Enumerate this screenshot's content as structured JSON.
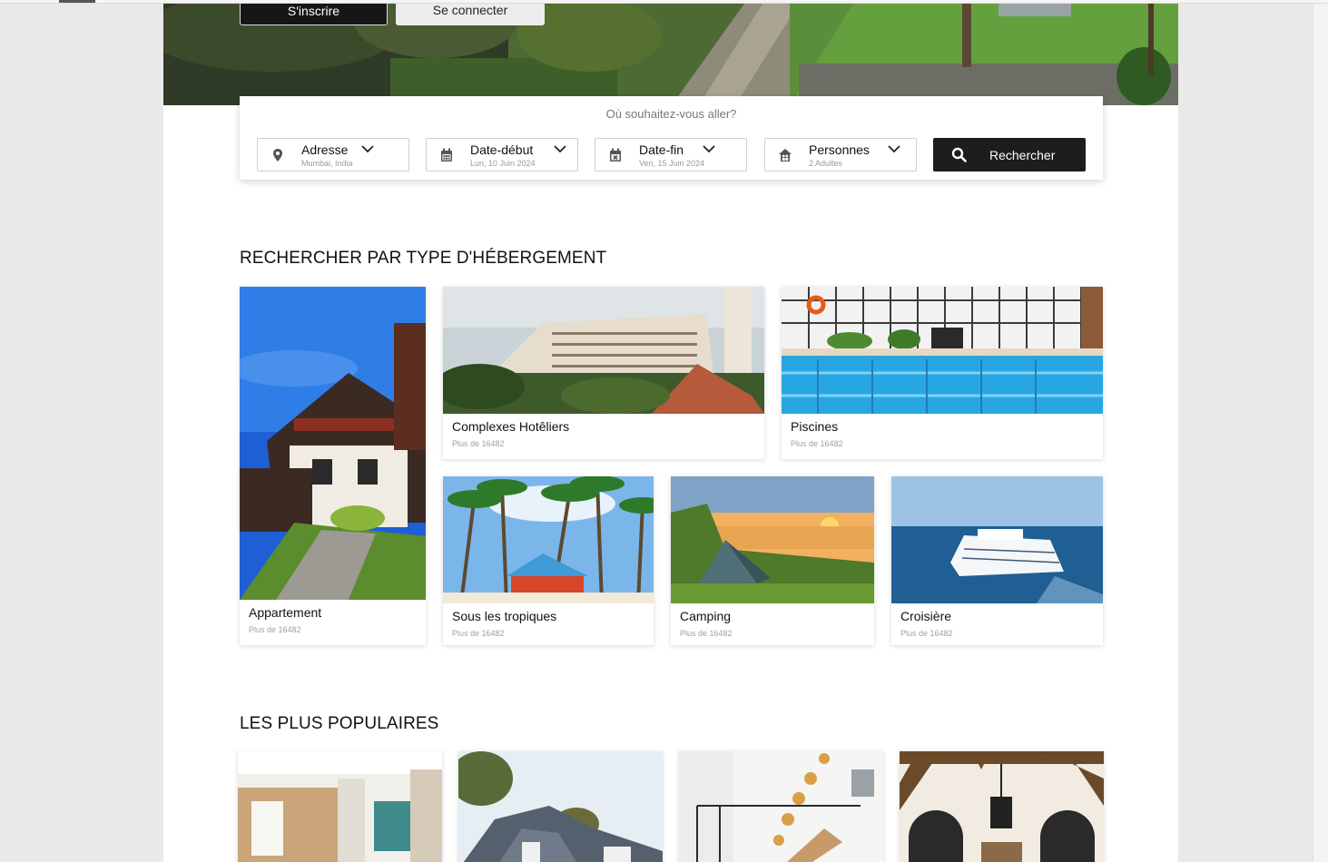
{
  "header": {
    "signup_label": "S'inscrire",
    "login_label": "Se connecter"
  },
  "search": {
    "question": "Où souhaitez-vous aller?",
    "fields": [
      {
        "label": "Adresse",
        "value": "Mumbai, India",
        "icon": "location-pin-icon"
      },
      {
        "label": "Date-début",
        "value": "Lun, 10 Juin 2024",
        "icon": "calendar-icon"
      },
      {
        "label": "Date-fin",
        "value": "Ven, 15 Juin 2024",
        "icon": "calendar-x-icon"
      },
      {
        "label": "Personnes",
        "value": "2 Adultes",
        "icon": "people-house-icon"
      }
    ],
    "button_label": "Rechercher"
  },
  "types_section": {
    "title": "RECHERCHER PAR TYPE D'HÉBERGEMENT",
    "items": [
      {
        "name": "Appartement",
        "meta": "Plus de 16482"
      },
      {
        "name": "Complexes Hotêliers",
        "meta": "Plus de 16482"
      },
      {
        "name": "Piscines",
        "meta": "Plus de 16482"
      },
      {
        "name": "Sous les tropiques",
        "meta": "Plus de 16482"
      },
      {
        "name": "Camping",
        "meta": "Plus de 16482"
      },
      {
        "name": "Croisière",
        "meta": "Plus de 16482"
      }
    ]
  },
  "popular_section": {
    "title": "LES PLUS POPULAIRES"
  },
  "colors": {
    "dark_button": "#1d1d1d",
    "card_bg": "#ffffff",
    "page_bg": "#e9e9e9"
  }
}
